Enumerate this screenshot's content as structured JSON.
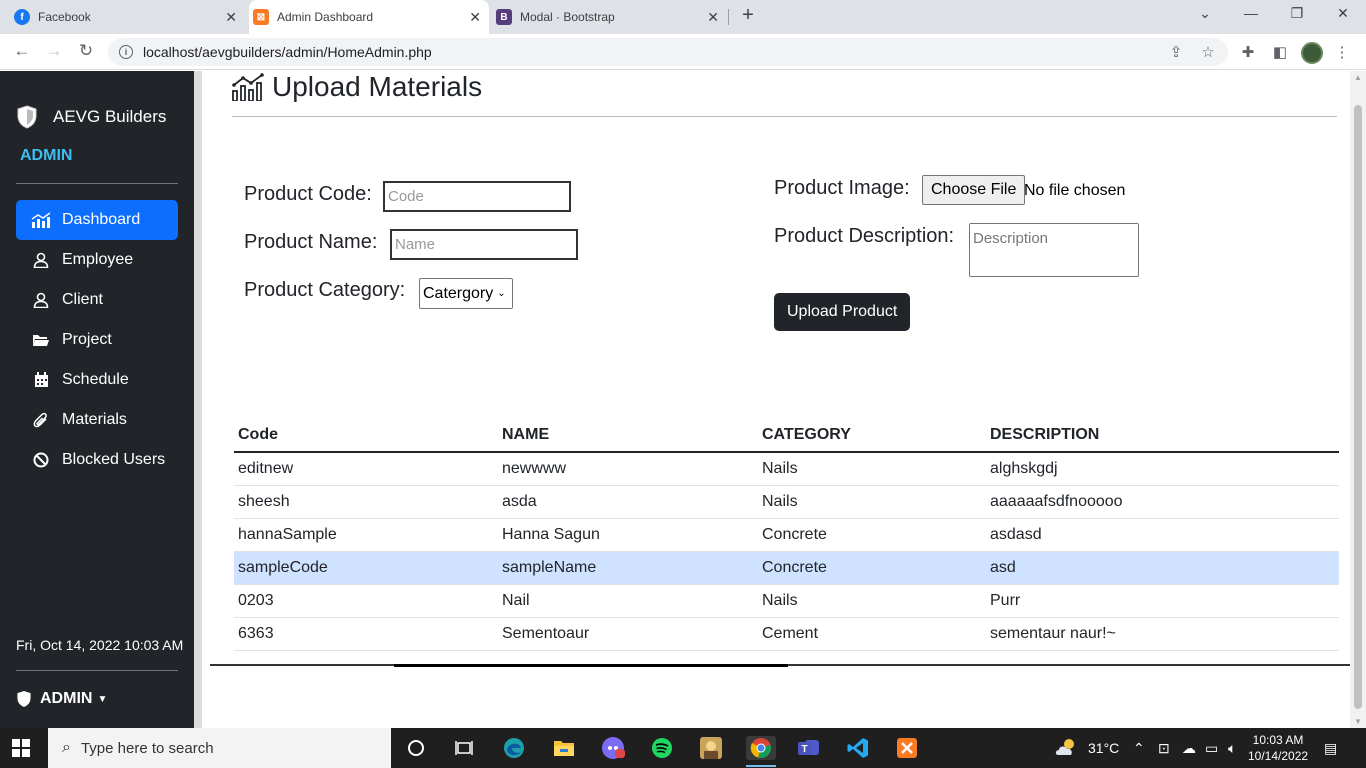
{
  "browser": {
    "tabs": [
      {
        "label": "Facebook",
        "icon": "facebook-icon",
        "active": false
      },
      {
        "label": "Admin Dashboard",
        "icon": "xampp-icon",
        "active": true
      },
      {
        "label": "Modal · Bootstrap",
        "icon": "bootstrap-icon",
        "active": false
      }
    ],
    "url": "localhost/aevgbuilders/admin/HomeAdmin.php"
  },
  "sidebar": {
    "brand": "AEVG Builders",
    "role_title": "ADMIN",
    "items": [
      {
        "label": "Dashboard",
        "icon": "chart-icon",
        "active": true
      },
      {
        "label": "Employee",
        "icon": "person-icon"
      },
      {
        "label": "Client",
        "icon": "person-icon"
      },
      {
        "label": "Project",
        "icon": "folder-icon"
      },
      {
        "label": "Schedule",
        "icon": "calendar-icon"
      },
      {
        "label": "Materials",
        "icon": "paperclip-icon"
      },
      {
        "label": "Blocked Users",
        "icon": "ban-icon"
      }
    ],
    "datetime": "Fri, Oct 14, 2022 10:03 AM",
    "user_menu": "ADMIN"
  },
  "main": {
    "title": "Upload Materials",
    "form": {
      "code_label": "Product Code:",
      "code_placeholder": "Code",
      "name_label": "Product Name:",
      "name_placeholder": "Name",
      "category_label": "Product Category:",
      "category_selected": "Catergory",
      "image_label": "Product Image:",
      "file_button": "Choose File",
      "file_status": "No file chosen",
      "description_label": "Product Description:",
      "description_placeholder": "Description",
      "submit": "Upload Product"
    },
    "table": {
      "headers": [
        "Code",
        "NAME",
        "CATEGORY",
        "DESCRIPTION"
      ],
      "rows": [
        [
          "editnew",
          "newwww",
          "Nails",
          "alghskgdj"
        ],
        [
          "sheesh",
          "asda",
          "Nails",
          "aaaaaafsdfnooooo"
        ],
        [
          "hannaSample",
          "Hanna Sagun",
          "Concrete",
          "asdasd"
        ],
        [
          "sampleCode",
          "sampleName",
          "Concrete",
          "asd"
        ],
        [
          "0203",
          "Nail",
          "Nails",
          "Purr"
        ],
        [
          "6363",
          "Sementoaur",
          "Cement",
          "sementaur naur!~"
        ]
      ],
      "highlighted_row": 3
    }
  },
  "taskbar": {
    "search_placeholder": "Type here to search",
    "temperature": "31°C",
    "time": "10:03 AM",
    "date": "10/14/2022"
  },
  "colors": {
    "sidebar_bg": "#212529",
    "accent": "#0d6efd",
    "admin_title": "#3dbcf0",
    "row_highlight": "#cfe2ff"
  }
}
